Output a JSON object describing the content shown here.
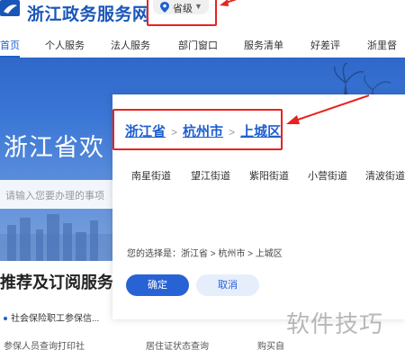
{
  "header": {
    "site_title": "浙江政务服务网",
    "province_selector": {
      "label": "省级",
      "icon": "location-pin-icon"
    }
  },
  "nav": {
    "items": [
      {
        "label": "首页",
        "active": true
      },
      {
        "label": "个人服务"
      },
      {
        "label": "法人服务"
      },
      {
        "label": "部门窗口"
      },
      {
        "label": "服务清单"
      },
      {
        "label": "好差评"
      },
      {
        "label": "浙里督"
      }
    ]
  },
  "hero": {
    "welcome_text": "浙江省欢",
    "search_placeholder": "请输入您要办理的事项"
  },
  "recommend": {
    "title": "推荐及订阅服务",
    "item1": "社会保险职工参保信...",
    "bottom_items": [
      "参保人员查询打印社",
      "居住证状态查询",
      "购买自"
    ]
  },
  "popup": {
    "breadcrumb": [
      "浙江省",
      "杭州市",
      "上城区"
    ],
    "streets": [
      "南星街道",
      "望江街道",
      "紫阳街道",
      "小营街道",
      "清波街道"
    ],
    "selection_text": "您的选择是：浙江省 > 杭州市 > 上城区",
    "confirm_label": "确定",
    "cancel_label": "取消"
  },
  "watermark": "软件技巧",
  "colors": {
    "brand_blue": "#1d5fd0",
    "annotation_red": "#e8231e",
    "confirm_button": "#2763d4",
    "cancel_button_bg": "#e7eefb"
  }
}
